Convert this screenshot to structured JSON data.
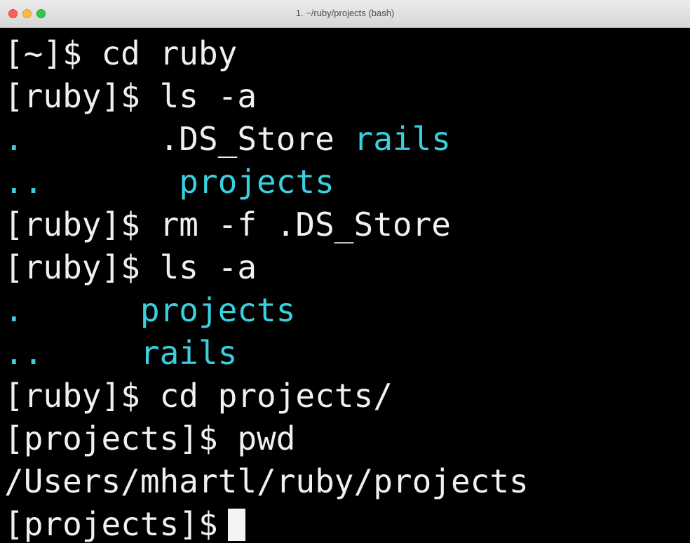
{
  "window": {
    "title": "1. ~/ruby/projects (bash)"
  },
  "terminal": {
    "lines": [
      {
        "prompt": "[~]$ ",
        "command": "cd ruby"
      },
      {
        "prompt": "[ruby]$ ",
        "command": "ls -a"
      },
      {
        "col1": ".",
        "col2": "       .DS_Store ",
        "col3": "rails"
      },
      {
        "col1": "..",
        "col2": "       ",
        "col3": "projects"
      },
      {
        "prompt": "[ruby]$ ",
        "command": "rm -f .DS_Store"
      },
      {
        "prompt": "[ruby]$ ",
        "command": "ls -a"
      },
      {
        "col1": ".",
        "col2": "      ",
        "col3": "projects"
      },
      {
        "col1": "..",
        "col2": "     ",
        "col3": "rails"
      },
      {
        "prompt": "[ruby]$ ",
        "command": "cd projects/"
      },
      {
        "prompt": "[projects]$ ",
        "command": "pwd"
      },
      {
        "output": "/Users/mhartl/ruby/projects"
      },
      {
        "prompt": "[projects]$",
        "command": ""
      }
    ]
  },
  "colors": {
    "background": "#000000",
    "text": "#f0f0f0",
    "directory": "#3ad0df"
  }
}
